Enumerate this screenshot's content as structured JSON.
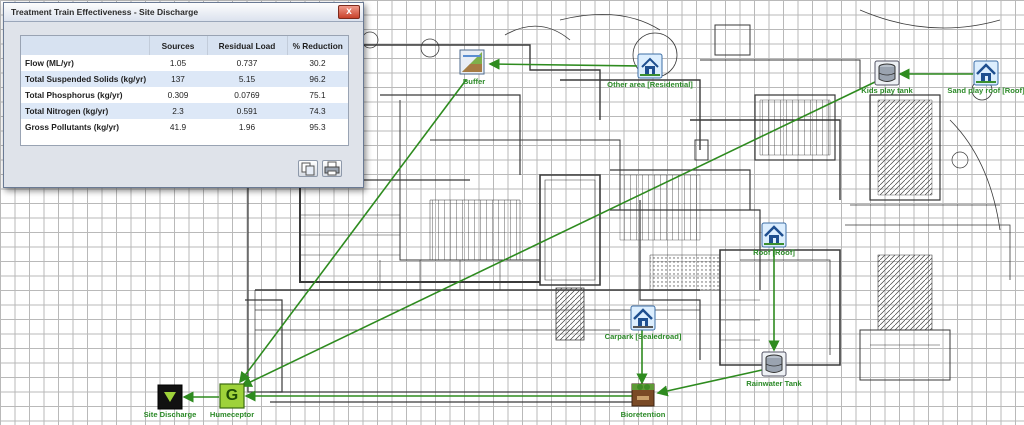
{
  "window": {
    "title": "Treatment Train Effectiveness - Site Discharge",
    "close_symbol": "x",
    "columns": [
      "",
      "Sources",
      "Residual Load",
      "% Reduction"
    ],
    "rows": [
      {
        "label": "Flow (ML/yr)",
        "sources": "1.05",
        "residual": "0.737",
        "reduction": "30.2"
      },
      {
        "label": "Total Suspended Solids (kg/yr)",
        "sources": "137",
        "residual": "5.15",
        "reduction": "96.2"
      },
      {
        "label": "Total Phosphorus (kg/yr)",
        "sources": "0.309",
        "residual": "0.0769",
        "reduction": "75.1"
      },
      {
        "label": "Total Nitrogen (kg/yr)",
        "sources": "2.3",
        "residual": "0.591",
        "reduction": "74.3"
      },
      {
        "label": "Gross Pollutants (kg/yr)",
        "sources": "41.9",
        "residual": "1.96",
        "reduction": "95.3"
      }
    ],
    "buttons": {
      "copy_icon": "copy-icon",
      "print_icon": "print-icon"
    }
  },
  "nodes": {
    "buffer": {
      "label": "Buffer",
      "icon": "buffer-icon"
    },
    "other_area": {
      "label": "Other area [Residential]",
      "icon": "residential-catchment-icon"
    },
    "kids_play_tank": {
      "label": "Kids play tank",
      "icon": "rainwater-tank-icon"
    },
    "sand_play_roof": {
      "label": "Sand play roof [Roof]",
      "icon": "roof-catchment-icon"
    },
    "roof": {
      "label": "Roof [Roof]",
      "icon": "roof-catchment-icon"
    },
    "carpark": {
      "label": "Carpark [Sealedroad]",
      "icon": "sealed-road-catchment-icon"
    },
    "rainwater_tank": {
      "label": "Rainwater Tank",
      "icon": "rainwater-tank-icon"
    },
    "bioretention": {
      "label": "Bioretention",
      "icon": "bioretention-icon"
    },
    "humeceptor": {
      "label": "Humeceptor",
      "icon": "gpt-icon",
      "glyph": "G"
    },
    "site_discharge": {
      "label": "Site Discharge",
      "icon": "receiving-node-icon"
    }
  },
  "colors": {
    "link": "#2e8b1f",
    "label": "#2c8a28",
    "grid": "#b9b9b9",
    "plan_line": "#3a3a3a"
  }
}
